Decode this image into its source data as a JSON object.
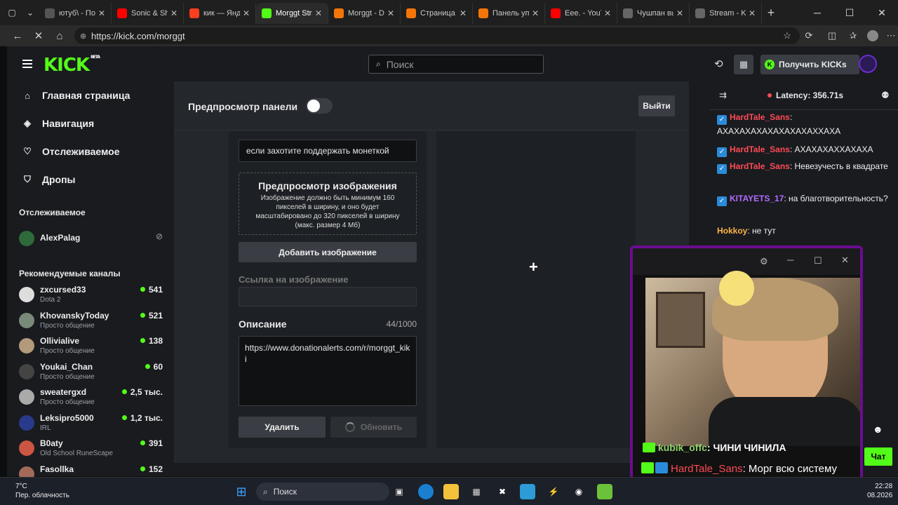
{
  "browser": {
    "tabs": [
      {
        "label": "ютуб\\ - Поиск",
        "fav": "search-icon",
        "active": false
      },
      {
        "label": "Sonic & Shadow",
        "fav": "youtube-icon",
        "active": false
      },
      {
        "label": "кик — Яндекс",
        "fav": "yandex-icon",
        "active": false
      },
      {
        "label": "Morggt Stream",
        "fav": "kick-icon",
        "active": true
      },
      {
        "label": "Morggt - Don",
        "fav": "donationalerts-icon",
        "active": false
      },
      {
        "label": "Страница до",
        "fav": "donationalerts-icon",
        "active": false
      },
      {
        "label": "Панель упра",
        "fav": "donationalerts-icon",
        "active": false
      },
      {
        "label": "Eee. - YouTube",
        "fav": "youtube-icon",
        "active": false
      },
      {
        "label": "Чушпан выш",
        "fav": "loading-icon",
        "active": false
      },
      {
        "label": "Stream - Kick",
        "fav": "loading-icon",
        "active": false
      }
    ],
    "url": "https://kick.com/morggt"
  },
  "header": {
    "logo": "KICK",
    "logo_badge": "BETA",
    "search_placeholder": "Поиск",
    "get_kicks": "Получить KICKs"
  },
  "sidebar": {
    "nav": [
      {
        "label": "Главная страница",
        "icon": "home-icon"
      },
      {
        "label": "Навигация",
        "icon": "compass-icon"
      },
      {
        "label": "Отслеживаемое",
        "icon": "heart-icon"
      },
      {
        "label": "Дропы",
        "icon": "gift-icon"
      }
    ],
    "following_title": "Отслеживаемое",
    "following": [
      {
        "name": "AlexPalag"
      }
    ],
    "recommended_title": "Рекомендуемые каналы",
    "recommended": [
      {
        "name": "zxcursed33",
        "game": "Dota 2",
        "viewers": "541"
      },
      {
        "name": "KhovanskyToday",
        "game": "Просто общение",
        "viewers": "521"
      },
      {
        "name": "Ollivialive",
        "game": "Просто общение",
        "viewers": "138"
      },
      {
        "name": "Youkai_Chan",
        "game": "Просто общение",
        "viewers": "60"
      },
      {
        "name": "sweatergxd",
        "game": "Просто общение",
        "viewers": "2,5 тыс."
      },
      {
        "name": "Leksipro5000",
        "game": "IRL",
        "viewers": "1,2 тыс."
      },
      {
        "name": "B0aty",
        "game": "Old School RuneScape",
        "viewers": "391"
      },
      {
        "name": "Fasollka",
        "game": "",
        "viewers": "152"
      }
    ]
  },
  "panel": {
    "preview_label": "Предпросмотр панели",
    "exit_label": "Выйти",
    "title_value": "если захотите поддержать монеткой",
    "image_preview_title": "Предпросмотр изображения",
    "image_preview_text": "Изображение должно быть минимум 160 пикселей в ширину, и оно будет масштабировано до 320 пикселей в ширину (макс. размер 4 Мб)",
    "add_image": "Добавить изображение",
    "image_link_label": "Ссылка на изображение",
    "image_link_value": "",
    "description_label": "Описание",
    "description_count": "44/1000",
    "description_value": "https://www.donationalerts.com/r/morggt_kiki",
    "delete": "Удалить",
    "update": "Обновить"
  },
  "chat": {
    "latency": "Latency: 356.71s",
    "messages": [
      {
        "user": "HardTale_Sans",
        "text": ": АХАХАХАХАХАХАХАХАХХАХА",
        "color": "#ff4a55"
      },
      {
        "user": "HardTale_Sans",
        "text": ": АХАХАХАХХАХАХА",
        "color": "#ff4a55"
      },
      {
        "user": "HardTale_Sans",
        "text": ": Невезучесть в квадрате",
        "color": "#ff4a55"
      },
      {
        "user": "KITAYETS_17",
        "text": ": на благотворительность?",
        "color": "#b36bff"
      },
      {
        "user": "Hokkoy",
        "text": ": не тут",
        "color": "#ffb347"
      }
    ],
    "overlay_line_user": "kubik_offc",
    "overlay_line_text": ": ЧИНИ ЧИНИЛА",
    "overlay_msg_user": "HardTale_Sans",
    "overlay_msg_text": ": Морг всю систему поломал ебанкрат",
    "chat_button": "Чат"
  },
  "taskbar": {
    "weather_temp": "7°C",
    "weather_desc": "Пер. облачность",
    "search": "Поиск",
    "time": "22:28",
    "date": "08.2026"
  },
  "colors": {
    "brand": "#53fc18",
    "username": "#ff4a55",
    "overlay_border": "#6b0c8f"
  }
}
